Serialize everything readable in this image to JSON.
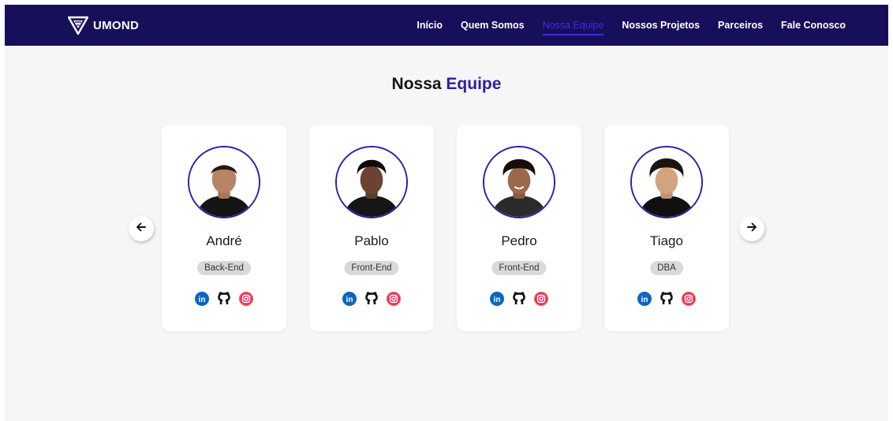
{
  "brand": {
    "name": "UMOND"
  },
  "nav": {
    "links": [
      {
        "label": "Início",
        "active": false
      },
      {
        "label": "Quem Somos",
        "active": false
      },
      {
        "label": "Nossa Equipe",
        "active": true
      },
      {
        "label": "Nossos Projetos",
        "active": false
      },
      {
        "label": "Parceiros",
        "active": false
      },
      {
        "label": "Fale Conosco",
        "active": false
      }
    ]
  },
  "section": {
    "title_part1": "Nossa",
    "title_part2": "Equipe"
  },
  "team": [
    {
      "name": "André",
      "role": "Back-End"
    },
    {
      "name": "Pablo",
      "role": "Front-End"
    },
    {
      "name": "Pedro",
      "role": "Front-End"
    },
    {
      "name": "Tiago",
      "role": "DBA"
    }
  ],
  "icons": {
    "prev": "arrow-left-icon",
    "next": "arrow-right-icon",
    "socials": [
      "linkedin-icon",
      "github-icon",
      "instagram-icon"
    ]
  },
  "colors": {
    "navbar": "#180f5a",
    "accent": "#2a1fa8",
    "active_link": "#3a2ee0",
    "background": "#f6f6f6",
    "badge": "#d9d9d9"
  }
}
